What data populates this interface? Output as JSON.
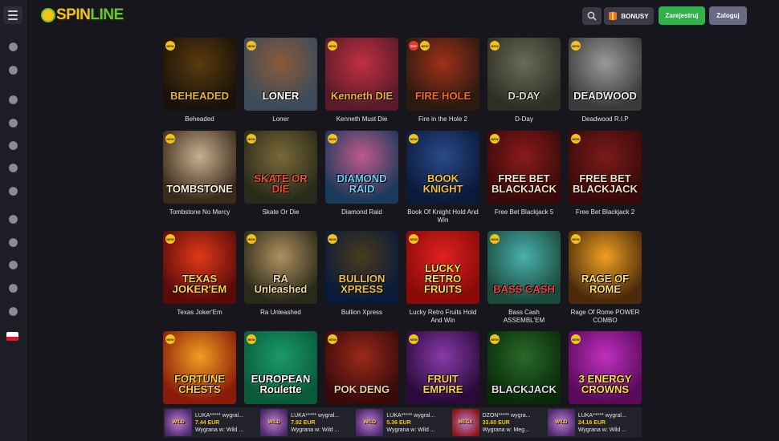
{
  "header": {
    "logo_part1": "SPIN",
    "logo_part2": "LINE",
    "bonus_label": "BONUSY",
    "register_label": "Zarejestruj",
    "login_label": "Zaloguj"
  },
  "sidebar": {
    "icons": [
      "user-icon",
      "user-icon",
      "briefcase-icon",
      "money-stack-icon",
      "basket-icon",
      "gem-icon",
      "crown-icon",
      "calendar-icon",
      "ticket-icon",
      "cards-icon",
      "trophy-icon",
      "target-icon"
    ],
    "language": "pl"
  },
  "games": [
    {
      "name": "Beheaded",
      "art": "BEHEADED",
      "badges": [
        "new"
      ],
      "colors": [
        "#1a1208",
        "#5a3a10"
      ],
      "text_color": "#e8b23a"
    },
    {
      "name": "Loner",
      "art": "LONER",
      "badges": [
        "new"
      ],
      "colors": [
        "#3c4a5a",
        "#8a5a3a"
      ],
      "text_color": "#ffffff"
    },
    {
      "name": "Kenneth Must Die",
      "art": "Kenneth DIE",
      "badges": [
        "new"
      ],
      "colors": [
        "#5a1a2a",
        "#c03040"
      ],
      "text_color": "#f4b03a"
    },
    {
      "name": "Fire in the Hole 2",
      "art": "FIRE HOLE",
      "badges": [
        "top",
        "new"
      ],
      "colors": [
        "#2a1a10",
        "#a0301a"
      ],
      "text_color": "#ff6a1a"
    },
    {
      "name": "D-Day",
      "art": "D-DAY",
      "badges": [
        "new"
      ],
      "colors": [
        "#2e3024",
        "#6a6a5a"
      ],
      "text_color": "#d8d8cc"
    },
    {
      "name": "Deadwood R.I.P",
      "art": "DEADWOOD",
      "badges": [
        "new"
      ],
      "colors": [
        "#3a3a3a",
        "#9a9a9a"
      ],
      "text_color": "#f0f0f0"
    },
    {
      "name": "Tombstone No Mercy",
      "art": "TOMBSTONE",
      "badges": [
        "new"
      ],
      "colors": [
        "#3a2a1a",
        "#c8b090"
      ],
      "text_color": "#fff4d8"
    },
    {
      "name": "Skate Or Die",
      "art": "SKATE OR DIE",
      "badges": [
        "new"
      ],
      "colors": [
        "#2a2a1a",
        "#7a6a3a"
      ],
      "text_color": "#f05030"
    },
    {
      "name": "Diamond Raid",
      "art": "DIAMOND RAID",
      "badges": [
        "new"
      ],
      "colors": [
        "#1a3a5a",
        "#c05a8a"
      ],
      "text_color": "#6ad0ff"
    },
    {
      "name": "Book Of Knight Hold And Win",
      "art": "BOOK KNIGHT",
      "badges": [
        "new"
      ],
      "colors": [
        "#0a1a3a",
        "#2a4a8a"
      ],
      "text_color": "#f0c040"
    },
    {
      "name": "Free Bet Blackjack 5",
      "art": "FREE BET BLACKJACK",
      "badges": [
        "new"
      ],
      "colors": [
        "#3a0a0a",
        "#8a1a1a"
      ],
      "text_color": "#f4e0c0"
    },
    {
      "name": "Free Bet Blackjack 2",
      "art": "FREE BET BLACKJACK",
      "badges": [
        "new"
      ],
      "colors": [
        "#3a0a0a",
        "#7a1a1a"
      ],
      "text_color": "#f4e0c0"
    },
    {
      "name": "Texas Joker'Em",
      "art": "TEXAS JOKER'EM",
      "badges": [
        "new"
      ],
      "colors": [
        "#5a0a0a",
        "#e03a1a"
      ],
      "text_color": "#ffd040"
    },
    {
      "name": "Ra Unleashed",
      "art": "RA Unleashed",
      "badges": [
        "new"
      ],
      "colors": [
        "#2a2a1a",
        "#b09060"
      ],
      "text_color": "#f0d8a0"
    },
    {
      "name": "Bullion Xpress",
      "art": "BULLION XPRESS",
      "badges": [
        "new"
      ],
      "colors": [
        "#0a1a3a",
        "#4a3a1a"
      ],
      "text_color": "#f0c040"
    },
    {
      "name": "Lucky Retro Fruits Hold And Win",
      "art": "LUCKY RETRO FRUITS",
      "badges": [
        "new"
      ],
      "colors": [
        "#8a0a0a",
        "#e02020"
      ],
      "text_color": "#ffe040"
    },
    {
      "name": "Bass Cash ASSEMBL'EM",
      "art": "BASS CASH",
      "badges": [
        "new"
      ],
      "colors": [
        "#1a4a3a",
        "#4ab0b0"
      ],
      "text_color": "#ff3a3a"
    },
    {
      "name": "Rage Of Rome POWER COMBO",
      "art": "RAGE OF ROME",
      "badges": [
        "new"
      ],
      "colors": [
        "#4a2a0a",
        "#f0a020"
      ],
      "text_color": "#ffe070"
    },
    {
      "name": "Fortune Chests",
      "art": "FORTUNE CHESTS",
      "badges": [
        "new"
      ],
      "colors": [
        "#8a1a0a",
        "#f0a020"
      ],
      "text_color": "#ffd040"
    },
    {
      "name": "European Roulette",
      "art": "EUROPEAN Roulette",
      "badges": [
        "new"
      ],
      "colors": [
        "#0a5a3a",
        "#1a9a6a"
      ],
      "text_color": "#ffffff"
    },
    {
      "name": "Pok Deng",
      "art": "POK DENG",
      "badges": [
        "new"
      ],
      "colors": [
        "#3a0a0a",
        "#9a2a1a"
      ],
      "text_color": "#f4d0a0"
    },
    {
      "name": "Fruit Empire",
      "art": "FRUIT EMPIRE",
      "badges": [
        "new"
      ],
      "colors": [
        "#2a0a3a",
        "#8a3aaa"
      ],
      "text_color": "#ffd040"
    },
    {
      "name": "Blackjack",
      "art": "BLACKJACK",
      "badges": [
        "new"
      ],
      "colors": [
        "#0a2a0a",
        "#2a6a2a"
      ],
      "text_color": "#e0e0e0"
    },
    {
      "name": "Energy Crowns",
      "art": "3 ENERGY CROWNS",
      "badges": [
        "new"
      ],
      "colors": [
        "#5a0a5a",
        "#c030c0"
      ],
      "text_color": "#ffe040"
    }
  ],
  "winners": [
    {
      "user": "LUKA***** wygral...",
      "amount": "7.44 EUR",
      "game": "Wygrana w: Wild ...",
      "thumb": "WILD",
      "color": "#4a2a6a"
    },
    {
      "user": "LUKA***** wygral...",
      "amount": "7.92 EUR",
      "game": "Wygrana w: Wild ...",
      "thumb": "WILD",
      "color": "#4a2a6a"
    },
    {
      "user": "LUKA***** wygral...",
      "amount": "5.36 EUR",
      "game": "Wygrana w: Wild ...",
      "thumb": "WILD",
      "color": "#4a2a6a"
    },
    {
      "user": "DZON***** wygra...",
      "amount": "33.60 EUR",
      "game": "Wygrana w: Meg...",
      "thumb": "MEGA",
      "color": "#8a1a1a"
    },
    {
      "user": "LUKA***** wygral...",
      "amount": "24.16 EUR",
      "game": "Wygrana w: Wild ...",
      "thumb": "WILD",
      "color": "#4a2a6a"
    }
  ]
}
